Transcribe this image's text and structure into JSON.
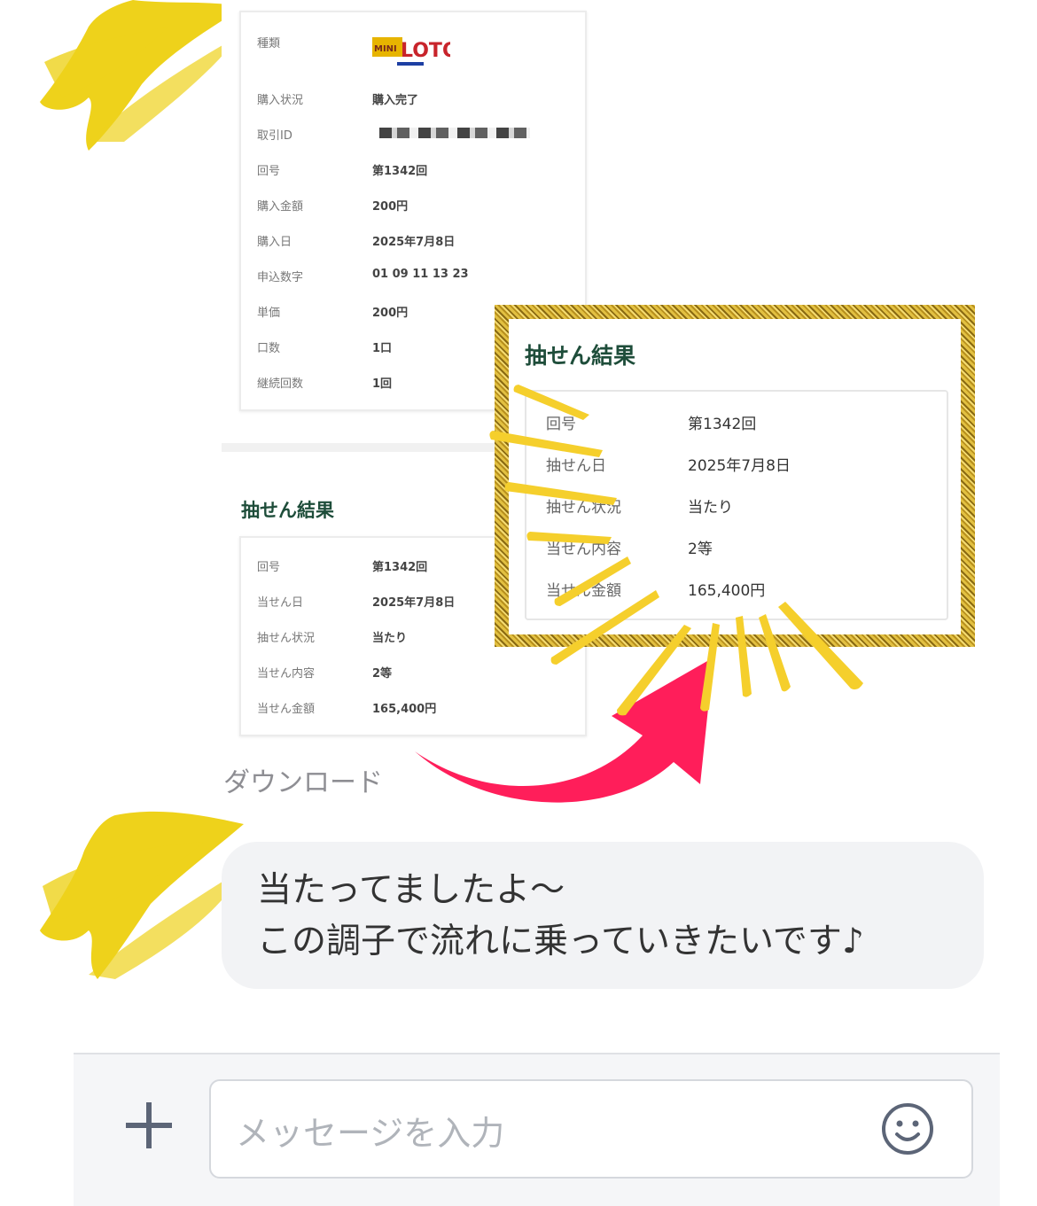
{
  "receipt": {
    "rows": [
      {
        "label": "種類",
        "value": ""
      },
      {
        "label": "購入状況",
        "value": "購入完了"
      },
      {
        "label": "取引ID",
        "value": ""
      },
      {
        "label": "回号",
        "value": "第1342回"
      },
      {
        "label": "購入金額",
        "value": "200円"
      },
      {
        "label": "購入日",
        "value": "2025年7月8日"
      },
      {
        "label": "申込数字",
        "value": "01 09 11 13 23"
      },
      {
        "label": "単価",
        "value": "200円"
      },
      {
        "label": "口数",
        "value": "1口"
      },
      {
        "label": "継続回数",
        "value": "1回"
      }
    ],
    "logo_text": "MINI LOTO"
  },
  "small_result": {
    "title": "抽せん結果",
    "rows": [
      {
        "label": "回号",
        "value": "第1342回"
      },
      {
        "label": "当せん日",
        "value": "2025年7月8日"
      },
      {
        "label": "抽せん状況",
        "value": "当たり"
      },
      {
        "label": "当せん内容",
        "value": "2等"
      },
      {
        "label": "当せん金額",
        "value": "165,400円"
      }
    ]
  },
  "highlight_result": {
    "title": "抽せん結果",
    "rows": [
      {
        "label": "回号",
        "value": "第1342回"
      },
      {
        "label": "抽せん日",
        "value": "2025年7月8日"
      },
      {
        "label": "抽せん状況",
        "value": "当たり"
      },
      {
        "label": "当せん内容",
        "value": "2等"
      },
      {
        "label": "当せん金額",
        "value": "165,400円"
      }
    ]
  },
  "download_label": "ダウンロード",
  "message": {
    "line1": "当たってましたよ〜",
    "line2": "この調子で流れに乗っていきたいです♪"
  },
  "input": {
    "placeholder": "メッセージを入力"
  },
  "icons": {
    "plus": "plus-icon",
    "emoji": "smiley-icon"
  },
  "colors": {
    "title_green": "#1e4d3a",
    "arrow_pink": "#ff1e5a",
    "burst_yellow": "#f5cf2c",
    "gold": "#c9a227"
  }
}
